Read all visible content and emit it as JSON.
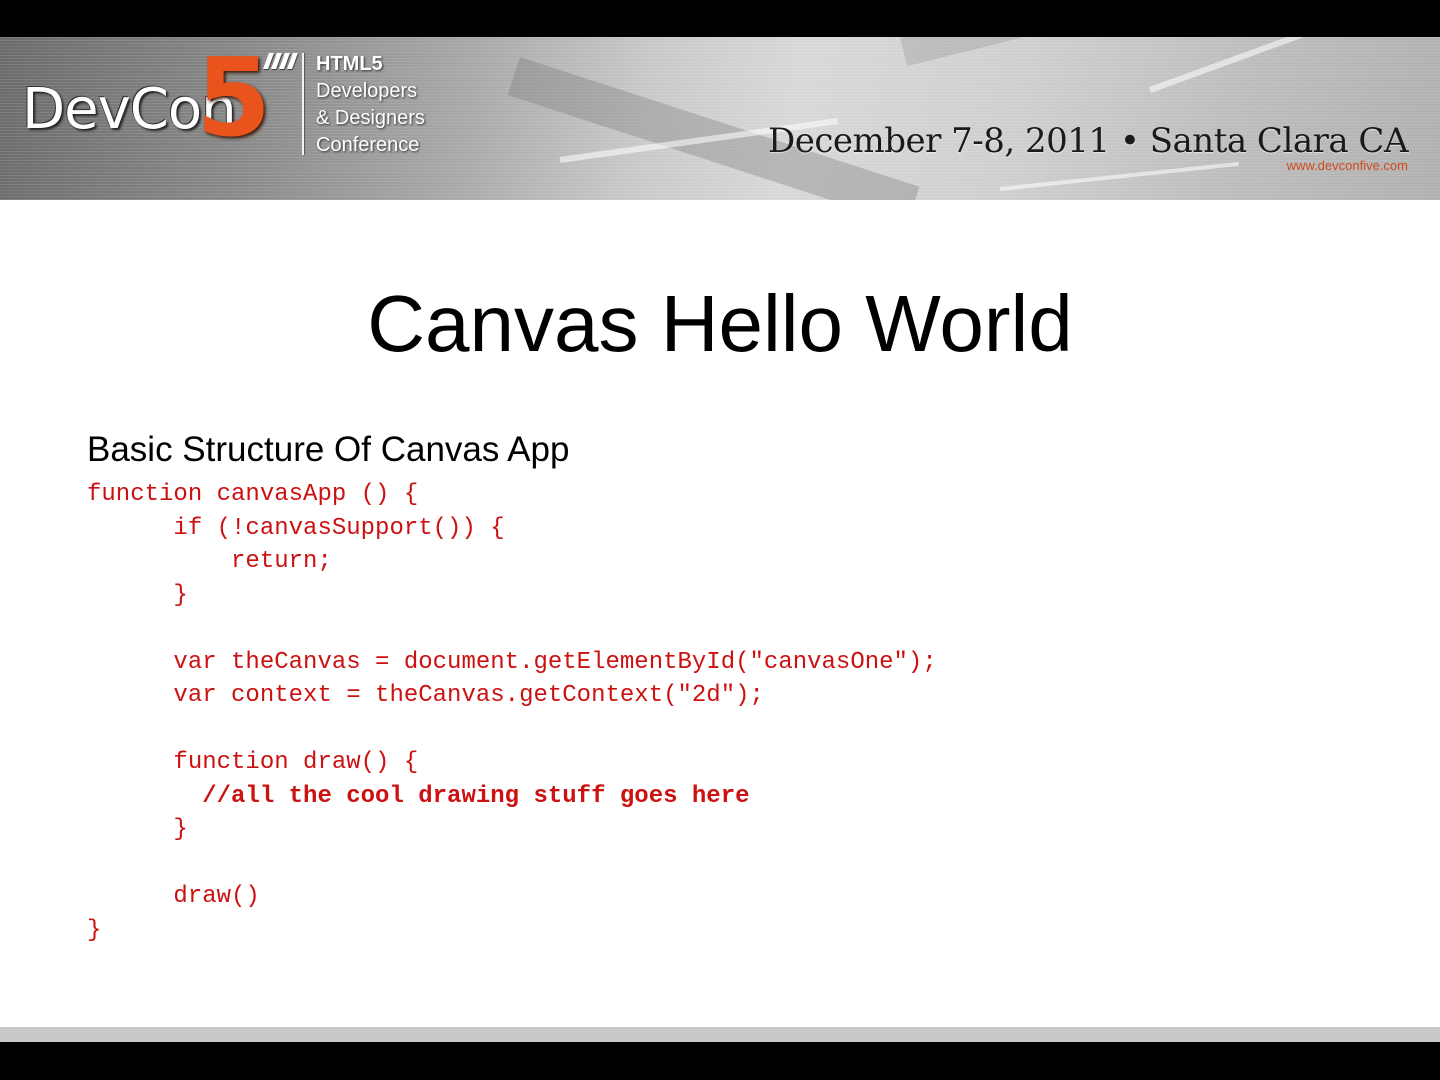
{
  "banner": {
    "logo_text": "DevCon",
    "logo_number": "5",
    "tagline": [
      "HTML5",
      "Developers",
      "& Designers",
      "Conference"
    ],
    "event_date": "December 7-8, 2011  •  Santa Clara CA",
    "event_url": "www.devconfive.com",
    "accent_color": "#e8541c"
  },
  "slide": {
    "title": "Canvas Hello World",
    "subtitle": "Basic Structure Of Canvas App",
    "code_color": "#cc1111",
    "code_lines": [
      {
        "text": "function canvasApp () {",
        "bold": false
      },
      {
        "text": "      if (!canvasSupport()) {",
        "bold": false
      },
      {
        "text": "          return;",
        "bold": false
      },
      {
        "text": "      }",
        "bold": false
      },
      {
        "text": "",
        "bold": false
      },
      {
        "text": "      var theCanvas = document.getElementById(\"canvasOne\");",
        "bold": false
      },
      {
        "text": "      var context = theCanvas.getContext(\"2d\");",
        "bold": false
      },
      {
        "text": "",
        "bold": false
      },
      {
        "text": "      function draw() {",
        "bold": false
      },
      {
        "text": "        //all the cool drawing stuff goes here",
        "bold": true
      },
      {
        "text": "      }",
        "bold": false
      },
      {
        "text": "",
        "bold": false
      },
      {
        "text": "      draw()",
        "bold": false
      },
      {
        "text": "}",
        "bold": false
      }
    ]
  }
}
